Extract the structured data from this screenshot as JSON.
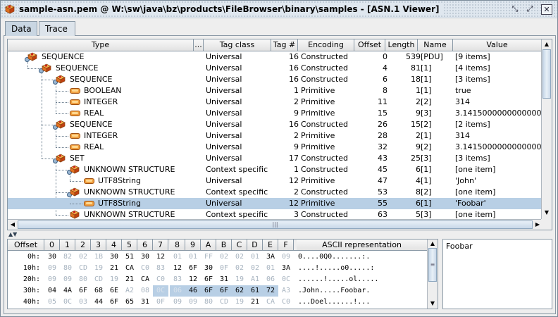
{
  "window": {
    "title": "sample-asn.pem @ W:\\sw\\java\\bz\\products\\FileBrowser\\binary\\samples - [ASN.1 Viewer]",
    "icon": "asn-package-icon",
    "buttons": {
      "minimize": "⤡",
      "restore": "⤢",
      "close": "✕"
    }
  },
  "tabs": [
    {
      "label": "Data",
      "active": true
    },
    {
      "label": "Trace",
      "active": false
    }
  ],
  "tree_table": {
    "columns": [
      "Type",
      "...",
      "Tag class",
      "Tag #",
      "Encoding",
      "Offset",
      "Length",
      "Name",
      "Value"
    ],
    "rows": [
      {
        "depth": 0,
        "icon": "box",
        "type": "SEQUENCE",
        "tag_class": "Universal",
        "tag": "16",
        "encoding": "Constructed",
        "offset": "0",
        "length": "539",
        "name": "[PDU]",
        "value": "[9 items]"
      },
      {
        "depth": 1,
        "icon": "box",
        "type": "SEQUENCE",
        "tag_class": "Universal",
        "tag": "16",
        "encoding": "Constructed",
        "offset": "4",
        "length": "81",
        "name": "[1]",
        "value": "[4 items]"
      },
      {
        "depth": 2,
        "icon": "box",
        "type": "SEQUENCE",
        "tag_class": "Universal",
        "tag": "16",
        "encoding": "Constructed",
        "offset": "6",
        "length": "18",
        "name": "[1]",
        "value": "[3 items]"
      },
      {
        "depth": 3,
        "icon": "pill",
        "type": "BOOLEAN",
        "tag_class": "Universal",
        "tag": "1",
        "encoding": "Primitive",
        "offset": "8",
        "length": "1",
        "name": "[1]",
        "value": "true"
      },
      {
        "depth": 3,
        "icon": "pill",
        "type": "INTEGER",
        "tag_class": "Universal",
        "tag": "2",
        "encoding": "Primitive",
        "offset": "11",
        "length": "2",
        "name": "[2]",
        "value": "314"
      },
      {
        "depth": 3,
        "icon": "pill",
        "type": "REAL",
        "tag_class": "Universal",
        "tag": "9",
        "encoding": "Primitive",
        "offset": "15",
        "length": "9",
        "name": "[3]",
        "value": "3.14150000000000006"
      },
      {
        "depth": 2,
        "icon": "box",
        "type": "SEQUENCE",
        "tag_class": "Universal",
        "tag": "16",
        "encoding": "Constructed",
        "offset": "26",
        "length": "15",
        "name": "[2]",
        "value": "[2 items]"
      },
      {
        "depth": 3,
        "icon": "pill",
        "type": "INTEGER",
        "tag_class": "Universal",
        "tag": "2",
        "encoding": "Primitive",
        "offset": "28",
        "length": "2",
        "name": "[1]",
        "value": "314"
      },
      {
        "depth": 3,
        "icon": "pill",
        "type": "REAL",
        "tag_class": "Universal",
        "tag": "9",
        "encoding": "Primitive",
        "offset": "32",
        "length": "9",
        "name": "[2]",
        "value": "3.14150000000000006"
      },
      {
        "depth": 2,
        "icon": "box",
        "type": "SET",
        "tag_class": "Universal",
        "tag": "17",
        "encoding": "Constructed",
        "offset": "43",
        "length": "25",
        "name": "[3]",
        "value": "[3 items]"
      },
      {
        "depth": 3,
        "icon": "box",
        "type": "UNKNOWN STRUCTURE",
        "tag_class": "Context specific",
        "tag": "1",
        "encoding": "Constructed",
        "offset": "45",
        "length": "6",
        "name": "[1]",
        "value": "[one item]"
      },
      {
        "depth": 4,
        "icon": "pill",
        "type": "UTF8String",
        "tag_class": "Universal",
        "tag": "12",
        "encoding": "Primitive",
        "offset": "47",
        "length": "4",
        "name": "[1]",
        "value": "'John'"
      },
      {
        "depth": 3,
        "icon": "box",
        "type": "UNKNOWN STRUCTURE",
        "tag_class": "Context specific",
        "tag": "2",
        "encoding": "Constructed",
        "offset": "53",
        "length": "8",
        "name": "[2]",
        "value": "[one item]"
      },
      {
        "depth": 4,
        "icon": "pill",
        "type": "UTF8String",
        "tag_class": "Universal",
        "tag": "12",
        "encoding": "Primitive",
        "offset": "55",
        "length": "6",
        "name": "[1]",
        "value": "'Foobar'",
        "selected": true
      },
      {
        "depth": 3,
        "icon": "box",
        "type": "UNKNOWN STRUCTURE",
        "tag_class": "Context specific",
        "tag": "3",
        "encoding": "Constructed",
        "offset": "63",
        "length": "5",
        "name": "[3]",
        "value": "[one item]"
      }
    ]
  },
  "hex_view": {
    "columns": [
      "Offset",
      "0",
      "1",
      "2",
      "3",
      "4",
      "5",
      "6",
      "7",
      "8",
      "9",
      "A",
      "B",
      "C",
      "D",
      "E",
      "F",
      "ASCII representation"
    ],
    "rows": [
      {
        "offset": "0h:",
        "bytes": [
          "30",
          "82",
          "02",
          "1B",
          "30",
          "51",
          "30",
          "12",
          "01",
          "01",
          "FF",
          "02",
          "02",
          "01",
          "3A",
          "09"
        ],
        "dim": [
          false,
          true,
          true,
          true,
          false,
          false,
          false,
          false,
          true,
          true,
          true,
          true,
          true,
          true,
          false,
          true
        ],
        "hl": [],
        "ascii": "0....0Q0.......:."
      },
      {
        "offset": "10h:",
        "bytes": [
          "09",
          "80",
          "CD",
          "19",
          "21",
          "CA",
          "C0",
          "83",
          "12",
          "6F",
          "30",
          "0F",
          "02",
          "02",
          "01",
          "3A"
        ],
        "dim": [
          true,
          true,
          true,
          true,
          false,
          false,
          true,
          true,
          false,
          false,
          false,
          true,
          true,
          true,
          true,
          false
        ],
        "hl": [],
        "ascii": "....!.....o0.....:"
      },
      {
        "offset": "20h:",
        "bytes": [
          "09",
          "09",
          "80",
          "CD",
          "19",
          "21",
          "CA",
          "C0",
          "83",
          "12",
          "6F",
          "31",
          "19",
          "A1",
          "06",
          "0C"
        ],
        "dim": [
          true,
          true,
          true,
          true,
          true,
          false,
          false,
          true,
          true,
          false,
          false,
          false,
          true,
          true,
          true,
          true
        ],
        "hl": [],
        "ascii": "......!.....ol....."
      },
      {
        "offset": "30h:",
        "bytes": [
          "04",
          "4A",
          "6F",
          "68",
          "6E",
          "A2",
          "08",
          "0C",
          "06",
          "46",
          "6F",
          "6F",
          "62",
          "61",
          "72",
          "A3"
        ],
        "dim": [
          false,
          false,
          false,
          false,
          false,
          true,
          true,
          true,
          true,
          false,
          false,
          false,
          false,
          false,
          false,
          true
        ],
        "hl": [
          7,
          8,
          9,
          10,
          11,
          12,
          13,
          14
        ],
        "ascii": ".John.....Foobar."
      },
      {
        "offset": "40h:",
        "bytes": [
          "05",
          "0C",
          "03",
          "44",
          "6F",
          "65",
          "31",
          "0F",
          "09",
          "09",
          "80",
          "CD",
          "19",
          "21",
          "CA",
          "C0"
        ],
        "dim": [
          true,
          true,
          true,
          false,
          false,
          false,
          false,
          true,
          true,
          true,
          true,
          true,
          true,
          false,
          true,
          true
        ],
        "hl": [],
        "ascii": "...Doel......!..."
      }
    ]
  },
  "text_preview": {
    "value": "Foobar"
  }
}
